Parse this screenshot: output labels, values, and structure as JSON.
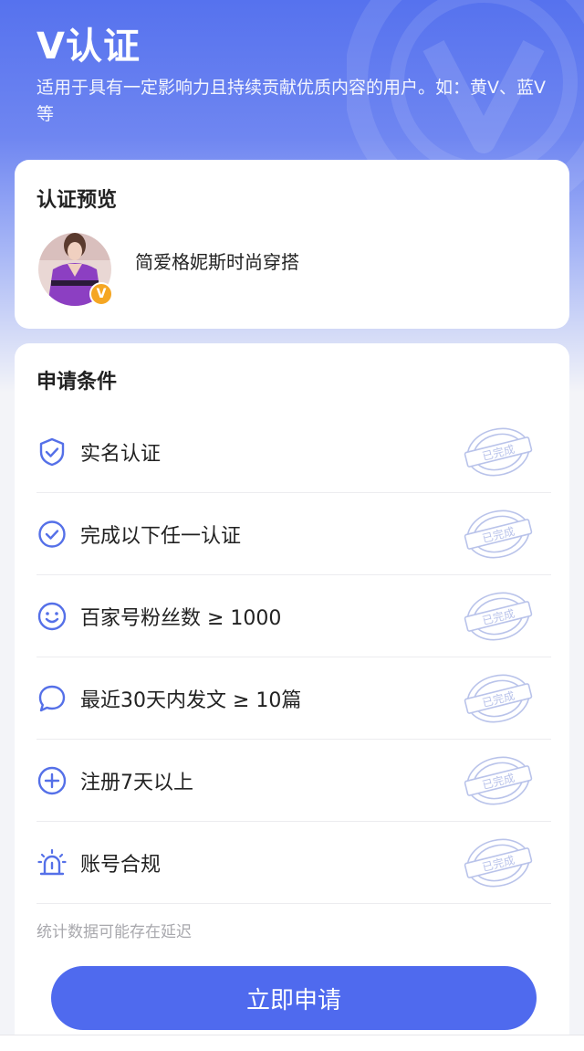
{
  "header": {
    "title": "V认证",
    "description": "适用于具有一定影响力且持续贡献优质内容的用户。如：黄V、蓝V等"
  },
  "preview": {
    "title": "认证预览",
    "name": "简爱格妮斯时尚穿搭",
    "badge": "V"
  },
  "conditions": {
    "title": "申请条件",
    "items": [
      {
        "label": "实名认证",
        "icon": "shield-check-icon",
        "stamp": "已完成"
      },
      {
        "label": "完成以下任一认证",
        "icon": "circle-check-icon",
        "stamp": "已完成"
      },
      {
        "label": "百家号粉丝数 ≥ 1000",
        "icon": "smiley-icon",
        "stamp": "已完成"
      },
      {
        "label": "最近30天内发文 ≥ 10篇",
        "icon": "chat-bubble-icon",
        "stamp": "已完成"
      },
      {
        "label": "注册7天以上",
        "icon": "plus-circle-icon",
        "stamp": "已完成"
      },
      {
        "label": "账号合规",
        "icon": "alarm-light-icon",
        "stamp": "已完成"
      }
    ],
    "note": "统计数据可能存在延迟"
  },
  "actions": {
    "apply_label": "立即申请"
  },
  "colors": {
    "accent": "#4f6aee",
    "icon": "#5570e8",
    "badge": "#f5a623",
    "stamp": "#b9c3ea"
  }
}
